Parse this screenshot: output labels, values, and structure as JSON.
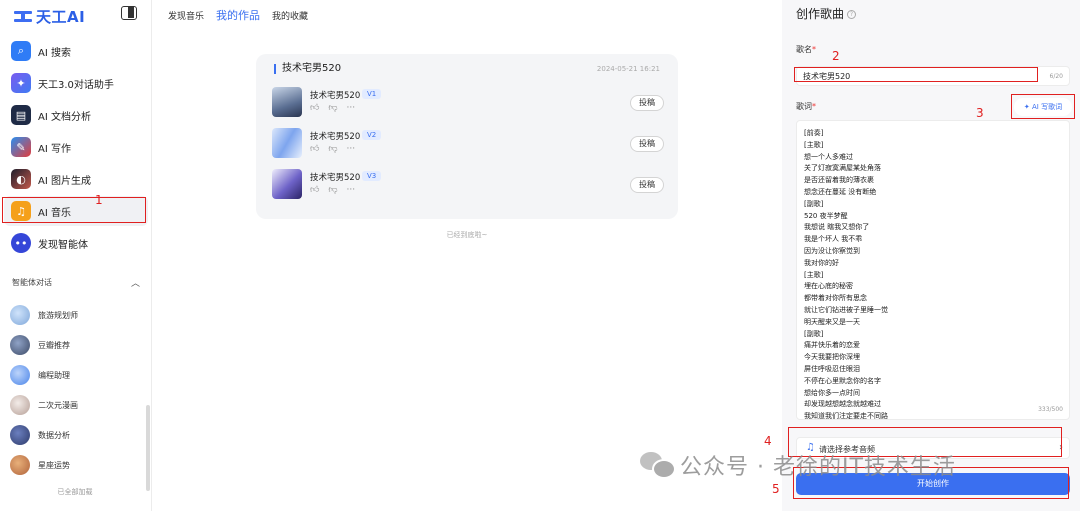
{
  "brand": {
    "name": "天工AI"
  },
  "sidebar": {
    "nav": [
      {
        "label": "AI 搜索",
        "icon": "search-icon",
        "color": "#2f7cf6"
      },
      {
        "label": "天工3.0对话助手",
        "icon": "chat-assistant-icon",
        "color": "#5b5be6"
      },
      {
        "label": "AI 文档分析",
        "icon": "document-analysis-icon",
        "color": "#1f2b46"
      },
      {
        "label": "AI 写作",
        "icon": "writing-icon",
        "color": "#2a2a3a"
      },
      {
        "label": "AI 图片生成",
        "icon": "image-generation-icon",
        "color": "#3b2230"
      },
      {
        "label": "AI 音乐",
        "icon": "music-icon",
        "color": "#f5a01a"
      },
      {
        "label": "发现智能体",
        "icon": "discover-agents-icon",
        "color": "#3546d8"
      }
    ],
    "section_title": "智能体对话",
    "agents": [
      {
        "label": "旅游规划师",
        "color": "#7fa7d9"
      },
      {
        "label": "豆瓣推荐",
        "color": "#3c4a66"
      },
      {
        "label": "编程助理",
        "color": "#4a84e8"
      },
      {
        "label": "二次元漫画",
        "color": "#d8c9c4"
      },
      {
        "label": "数据分析",
        "color": "#2d3a6a"
      },
      {
        "label": "星座运势",
        "color": "#b0623a"
      }
    ],
    "loaded_all": "已全部加载"
  },
  "topnav": {
    "tabs": [
      "发现音乐",
      "我的作品",
      "我的收藏"
    ],
    "active": "我的作品"
  },
  "works": {
    "title": "技术宅男520",
    "date": "2024-05-21 16:21",
    "songs": [
      {
        "name": "技术宅男520",
        "version": "V1",
        "submit": "投稿",
        "cover": "#7d93b8"
      },
      {
        "name": "技术宅男520",
        "version": "V2",
        "submit": "投稿",
        "cover": "#9ab8ef"
      },
      {
        "name": "技术宅男520",
        "version": "V3",
        "submit": "投稿",
        "cover": "#6e63c8"
      }
    ],
    "action_icons": [
      "thumbs-up-icon",
      "thumbs-down-icon",
      "more-icon"
    ],
    "end_text": "已经到底啦~"
  },
  "panel": {
    "title": "创作歌曲",
    "name_label": "歌名",
    "name_value": "技术宅男520",
    "name_count": "6/20",
    "lyrics_label": "歌词",
    "ai_write": "AI 写歌词",
    "lyrics": [
      "[前奏]",
      "[主歌]",
      "想一个人多难过",
      "关了灯寂寞满屋某处角落",
      "是否还留着我的薄衣裹",
      "想念还在蔓延 没有断绝",
      "[副歌]",
      "520 夜半梦醒",
      "我想说 瞎我又想你了",
      "我是个坏人 我不乖",
      "因为没让你察觉到",
      "我对你的好",
      "[主歌]",
      "埋在心底的秘密",
      "都带着对你所有思念",
      "就让它们钻进被子里睡一觉",
      "明天醒来又是一天",
      "[副歌]",
      "痛并快乐着的恋爱",
      "今天我要把你深埋",
      "屏住呼吸忍住眼泪",
      "不停在心里默念你的名字",
      "想给你多一点时间",
      "却发现越想越念就越难过",
      "我知道我们注定要走不同路"
    ],
    "lyrics_count": "333/500",
    "ref_audio": "请选择参考音频",
    "start_button": "开始创作"
  },
  "annotations": [
    "1",
    "2",
    "3",
    "4",
    "5"
  ],
  "watermark": "公众号 · 老徐的IT技术生活",
  "colors": {
    "accent": "#3a6ff0",
    "annotation": "#e02020"
  }
}
